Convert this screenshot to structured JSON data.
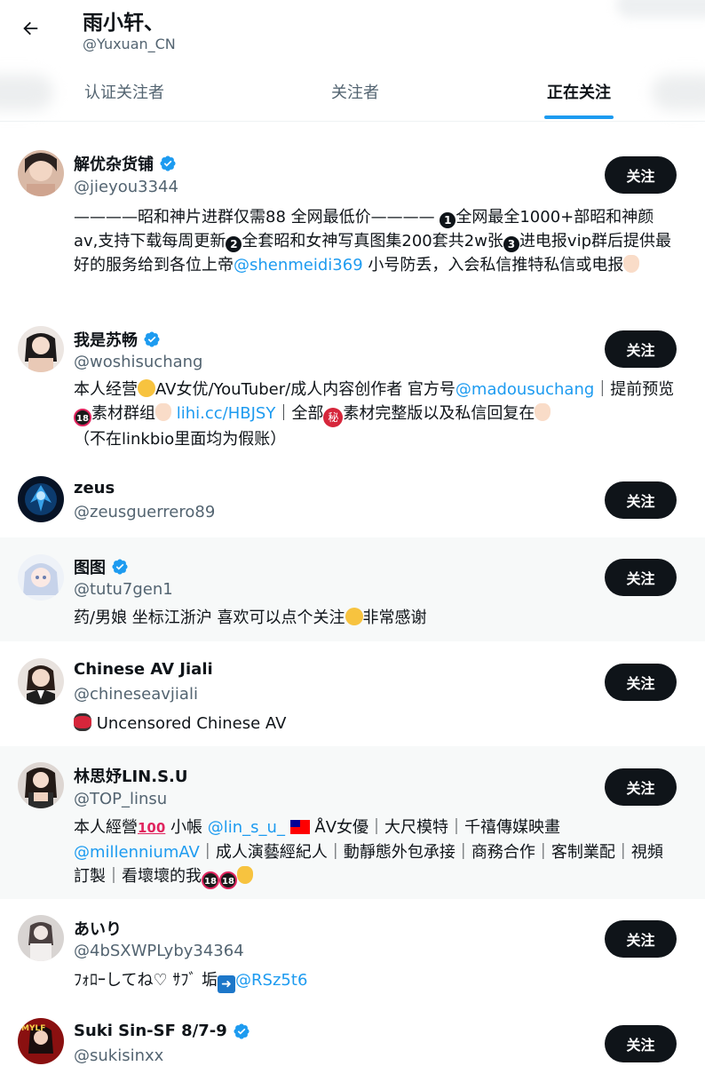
{
  "header": {
    "name": "雨小轩、",
    "handle": "@Yuxuan_CN"
  },
  "tabs": [
    {
      "label": "认证关注者",
      "active": false
    },
    {
      "label": "关注者",
      "active": false
    },
    {
      "label": "正在关注",
      "active": true
    }
  ],
  "follow_label": "关注",
  "users": [
    {
      "name": "解优杂货铺",
      "verified": true,
      "handle": "@jieyou3344",
      "bio": {
        "p1": "————昭和神片进群仅需88 全网最低价———— ",
        "p2": "全网最全1000+部昭和神颜av,支持下载每周更新",
        "p3": "全套昭和女神写真图集200套共2w张",
        "p4": "进电报vip群后提供最好的服务给到各位上帝",
        "link1": "@shenmeidi369",
        "p5": " 小号防丢，入会私信推特私信或电报",
        "n1": "1",
        "n2": "2",
        "n3": "3"
      }
    },
    {
      "name": "我是苏畅",
      "verified": true,
      "handle": "@woshisuchang",
      "bio": {
        "p1": "本人经营",
        "p2": "AV女优/YouTuber/成人内容创作者 官方号",
        "link1": "@madousuchang",
        "p3": "｜提前预览",
        "p4": "素材群组",
        "link2": "lihi.cc/HBJSY",
        "p5": "｜全部",
        "p6": "素材完整版以及私信回复在",
        "p7": "（不在linkbio里面均为假账）",
        "badge": "18",
        "secret": "秘"
      }
    },
    {
      "name": "zeus",
      "verified": false,
      "handle": "@zeusguerrero89"
    },
    {
      "name": "图图",
      "verified": true,
      "handle": "@tutu7gen1",
      "bio": {
        "p1": "药/男娘 坐标江浙沪 喜欢可以点个关注",
        "p2": "非常感谢"
      }
    },
    {
      "name": "Chinese AV Jiali",
      "verified": false,
      "handle": "@chineseavjiali",
      "bio": {
        "p1": " Uncensored Chinese AV"
      }
    },
    {
      "name": "林思妤LIN.S.U",
      "verified": false,
      "handle": "@TOP_linsu",
      "bio": {
        "p1": "本人經營",
        "hundred": "100",
        "p2": " 小帳 ",
        "link1": "@lin_s_u_",
        "p3": " ÅV女優｜大尺模特｜千禧傳媒映畫",
        "link2": "@millenniumAV",
        "p4": "｜成人演藝經紀人｜動靜態外包承接｜商務合作｜客制業配｜視頻訂製｜看壞壞的我",
        "badge": "18"
      }
    },
    {
      "name": "あいり",
      "verified": false,
      "handle": "@4bSXWPLyby34364",
      "bio": {
        "p1": "ﾌｫﾛｰしてね♡ ｻﾌﾞ 垢",
        "arrow": "➜",
        "link1": "@RSz5t6"
      }
    },
    {
      "name": "Suki Sin-SF 8/7-9",
      "verified": true,
      "handle": "@sukisinxx"
    }
  ],
  "colors": {
    "accent": "#1d9bf0",
    "text": "#0f1419",
    "muted": "#536471",
    "button_bg": "#0f1419"
  }
}
